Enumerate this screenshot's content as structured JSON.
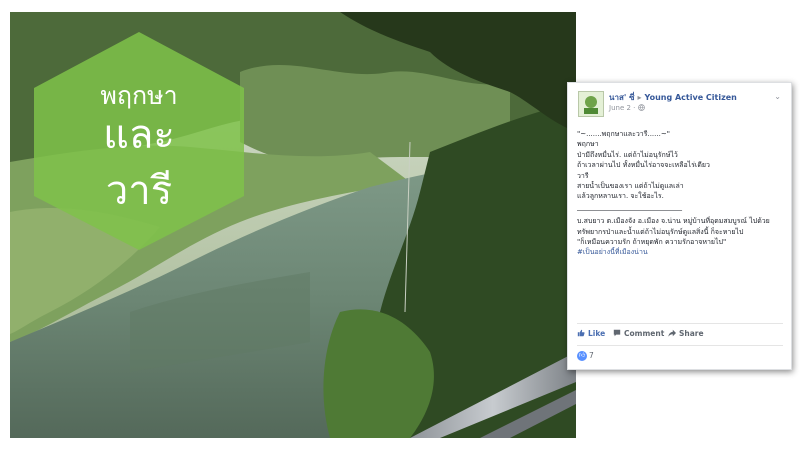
{
  "overlay": {
    "line1": "พฤกษา",
    "line2": "และ",
    "line3": "วารี",
    "hex_color": "#7fc24a"
  },
  "post": {
    "author": "นาส' ซี่",
    "arrow": "▸",
    "page_name": "Young Active Citizen",
    "date": "June 2 · ",
    "globe_icon": "globe-icon",
    "lines": [
      "\"~.......พฤกษาและวารี......~\"",
      "พฤกษา",
      "ป่ามีถึงหมื่นไร่. แต่ถ้าไม่อนุรักษ์ไว้",
      "ถ้าเวลาผ่านไป ทั้งหมื่นไร่อาจจะเหลือไร่เดียว",
      "วารี",
      "สายน้ำเป็นของเรา แต่ถ้าไม่ดูแลเล่า",
      "แล้วลูกหลานเรา. จะใช้อะไร."
    ],
    "separator": "______________________________",
    "body2": "บ.สบยาว ต.เมืองจัง อ.เมือง จ.น่าน หมู่บ้านที่อุดมสมบูรณ์ ไปด้วยทรัพยากรป่าและน้ำแต่ถ้าไม่อนุรักษ์ดูแลสิ่งนี้ ก็จะหายไป",
    "quote": "\"ก็เหมือนความรัก ถ้าหยุดพัก ความรักอาจหายไป\"",
    "hashtag": "#เป็นอย่างนี้ที่เมืองน่าน",
    "like_label": "Like",
    "comment_label": "Comment",
    "share_label": "Share",
    "reaction_count": "7"
  }
}
